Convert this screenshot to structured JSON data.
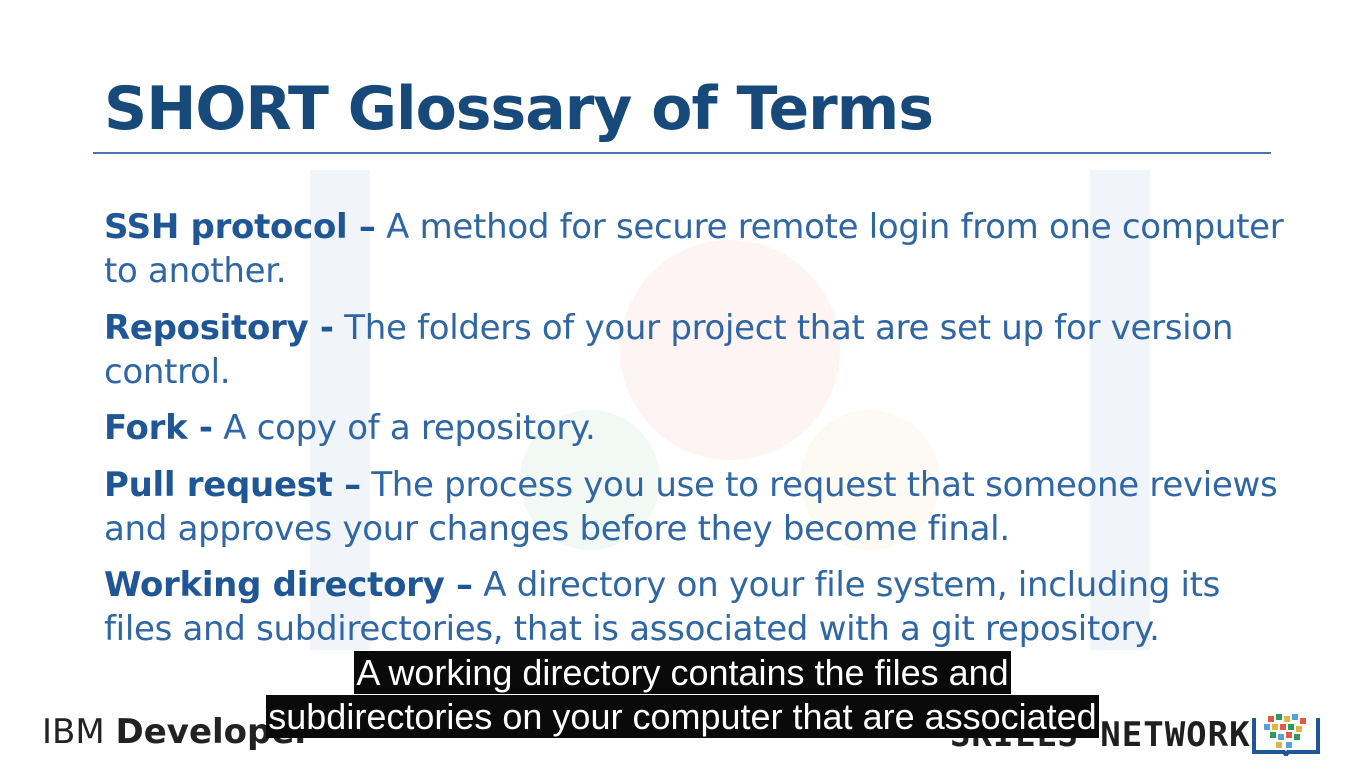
{
  "slide": {
    "title": "SHORT Glossary of Terms",
    "terms": [
      {
        "term": "SSH protocol –",
        "definition": " A method for secure remote login from one computer to another."
      },
      {
        "term": "Repository -",
        "definition": " The folders of your project that are set up for version control."
      },
      {
        "term": "Fork -",
        "definition": " A copy of a repository."
      },
      {
        "term": "Pull request –",
        "definition": " The process you use to request that someone reviews and approves your changes before they become final."
      },
      {
        "term": "Working directory –",
        "definition": " A directory on your file system, including its files and subdirectories, that is associated with a git repository."
      }
    ]
  },
  "captions": {
    "line1": "A working directory contains the files and",
    "line2": "subdirectories on your computer that are associated"
  },
  "footer": {
    "ibm_prefix": "IBM ",
    "ibm_word": "Developer",
    "skills": "SKILLS NETWORK",
    "book_icon": "book-icon"
  },
  "colors": {
    "title": "#17497a",
    "term": "#1f5695",
    "text": "#2f66a5",
    "rule": "#4d73a9",
    "caption_bg": "#0a0a0a"
  }
}
